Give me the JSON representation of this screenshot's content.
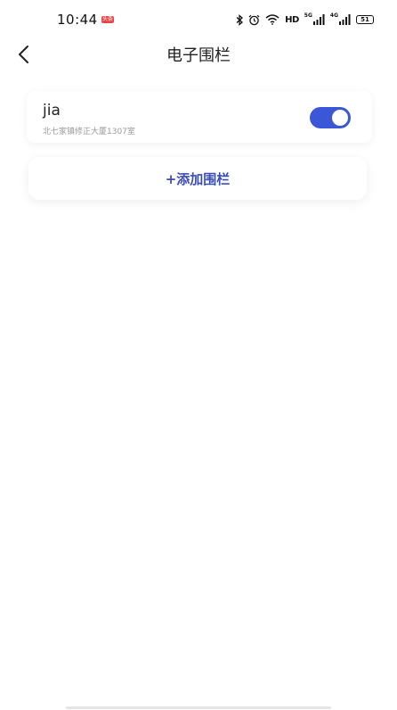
{
  "status_bar": {
    "time": "10:44",
    "app_badge": "头条",
    "hd_label": "HD",
    "net1_label": "5G",
    "net2_label": "4G",
    "battery": "51",
    "icons": [
      "bluetooth-icon",
      "alarm-icon",
      "wifi-icon",
      "hd-icon",
      "signal-5g-icon",
      "signal-4g-icon",
      "battery-icon"
    ]
  },
  "nav": {
    "back_icon": "chevron-left-icon",
    "title": "电子围栏"
  },
  "fences": [
    {
      "name": "jia",
      "address": "北七家镇修正大厦1307室",
      "enabled": true
    }
  ],
  "add_button": {
    "label": "+添加围栏"
  },
  "colors": {
    "accent": "#3b56d6",
    "add_label": "#3a4db8",
    "muted": "#9a9a9a",
    "background": "#ffffff"
  }
}
